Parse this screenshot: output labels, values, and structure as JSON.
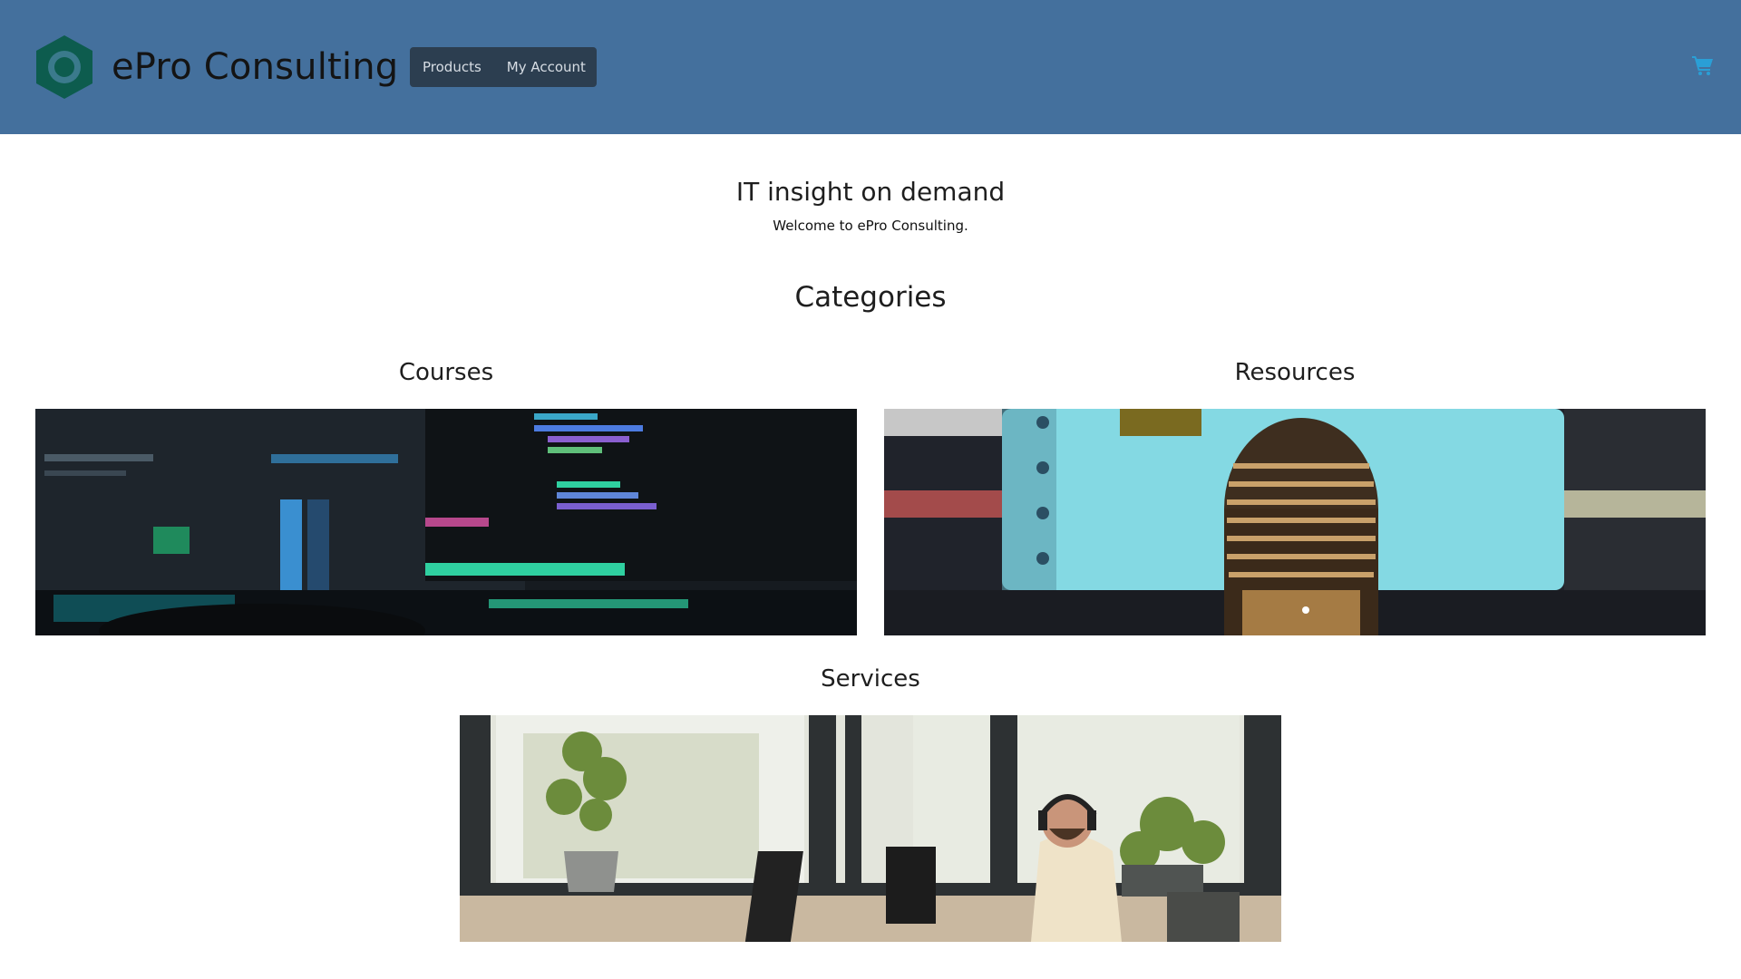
{
  "header": {
    "brand": "ePro Consulting",
    "nav": [
      "Products",
      "My Account"
    ],
    "logo_icon": "hexagon-ring-icon",
    "cart_icon": "shopping-cart-icon",
    "colors": {
      "header_bg": "#44709d",
      "nav_bg": "#2c3e50",
      "logo": "#0d5c4e",
      "cart": "#2a9fd6"
    }
  },
  "hero": {
    "title": "IT insight on demand",
    "subtitle": "Welcome to ePro Consulting."
  },
  "categories": {
    "heading": "Categories",
    "items": [
      {
        "title": "Courses"
      },
      {
        "title": "Resources"
      },
      {
        "title": "Services"
      }
    ]
  }
}
